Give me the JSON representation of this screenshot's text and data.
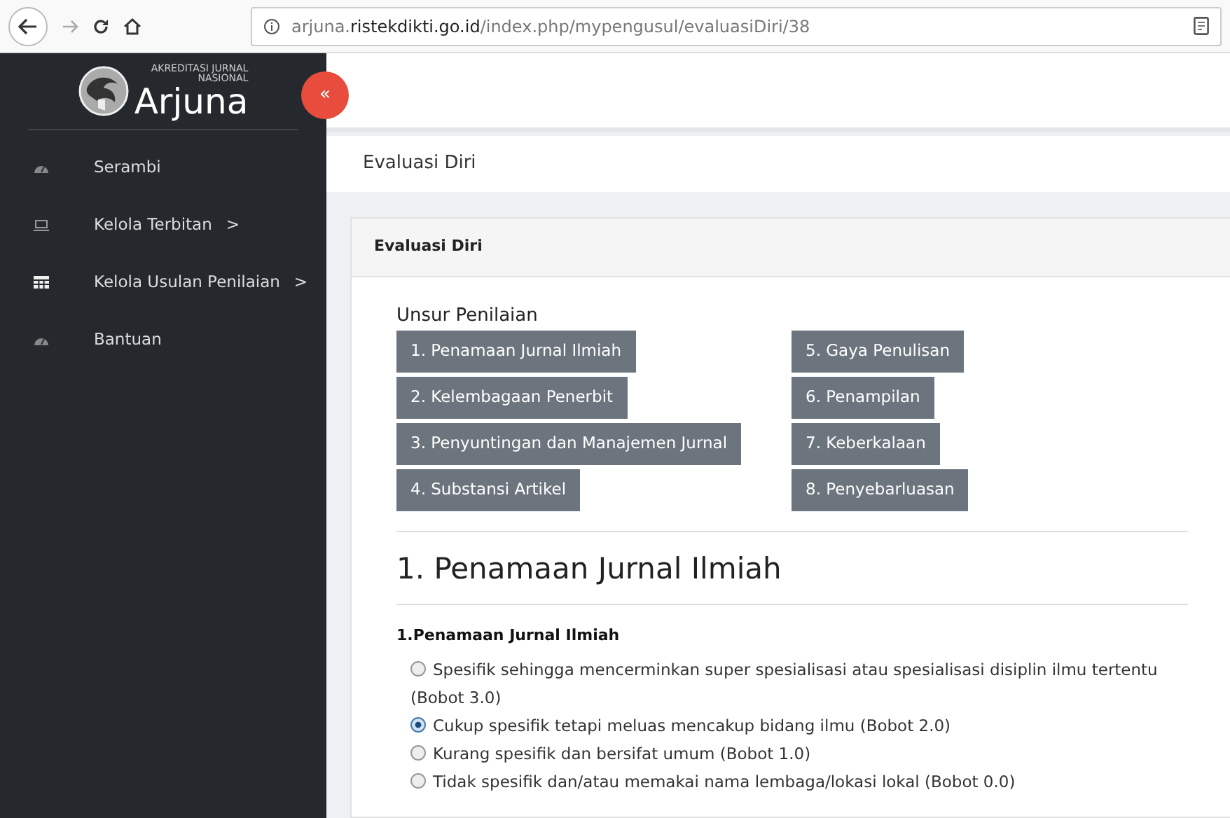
{
  "browser": {
    "url": "arjuna.**ristekdikti.go.id**/index.php/mypengusul/evaluasiDiri/38"
  },
  "sidebar": {
    "logo": {
      "subtitle_1": "AKREDITASI JURNAL",
      "subtitle_2": "NASIONAL",
      "title": "Arjuna"
    },
    "collapse_button": "«",
    "items": [
      {
        "label": "Serambi",
        "kind": "gauge"
      },
      {
        "label": "Kelola Terbitan",
        "kind": "laptop",
        "arrow": ">"
      },
      {
        "label": "Kelola Usulan Penilaian",
        "kind": "table",
        "arrow": ">"
      },
      {
        "label": "Bantuan",
        "kind": "gauge"
      }
    ]
  },
  "breadcrumb": "Evaluasi Diri",
  "card": {
    "header": "Evaluasi Diri",
    "section_label": "Unsur Penilaian",
    "buttons": [
      "1. Penamaan Jurnal Ilmiah",
      "2. Kelembagaan Penerbit",
      "3. Penyuntingan dan Manajemen Jurnal",
      "4. Substansi Artikel",
      "5. Gaya Penulisan",
      "6. Penampilan",
      "7. Keberkalaan",
      "8. Penyebarluasan"
    ],
    "heading": "1. Penamaan Jurnal Ilmiah",
    "question": "1.Penamaan Jurnal Ilmiah",
    "options": [
      {
        "label": "Spesifik sehingga mencerminkan super spesialisasi atau spesialisasi disiplin ilmu tertentu (Bobot 3.0)",
        "selected": false
      },
      {
        "label": "Cukup spesifik tetapi meluas mencakup bidang ilmu (Bobot 2.0)",
        "selected": true
      },
      {
        "label": "Kurang spesifik dan bersifat umum (Bobot 1.0)",
        "selected": false
      },
      {
        "label": "Tidak spesifik dan/atau memakai nama lembaga/lokasi lokal (Bobot 0.0)",
        "selected": false
      }
    ]
  }
}
